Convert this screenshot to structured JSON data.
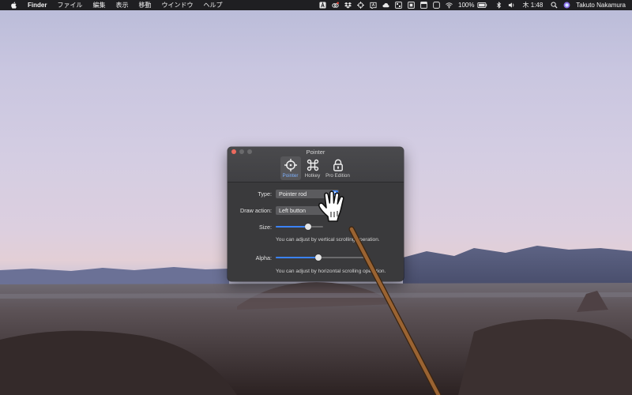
{
  "menubar": {
    "app_name": "Finder",
    "menus": [
      "ファイル",
      "編集",
      "表示",
      "移動",
      "ウインドウ",
      "ヘルプ"
    ],
    "battery": "100%",
    "clock": "木 1:48",
    "user": "Takuto Nakamura"
  },
  "window": {
    "title": "Pointer",
    "tabs": [
      {
        "label": "Pointer",
        "icon": "crosshair-icon"
      },
      {
        "label": "Hotkey",
        "icon": "command-key-icon"
      },
      {
        "label": "Pro Edition",
        "icon": "lock-icon"
      }
    ],
    "selected_tab": "Pointer",
    "type_label": "Type:",
    "type_value": "Pointer rod",
    "draw_action_label": "Draw action:",
    "draw_action_value": "Left button",
    "size_label": "Size:",
    "size_value": 0.68,
    "size_hint": "You can adjust by vertical scrolling operation.",
    "alpha_label": "Alpha:",
    "alpha_value": 0.47,
    "alpha_hint": "You can adjust by horizontal scrolling operation."
  },
  "colors": {
    "accent": "#3b82f6",
    "close": "#ed6a5e",
    "window_bg": "#3a3a3c",
    "rod": "#8b5a2b"
  }
}
